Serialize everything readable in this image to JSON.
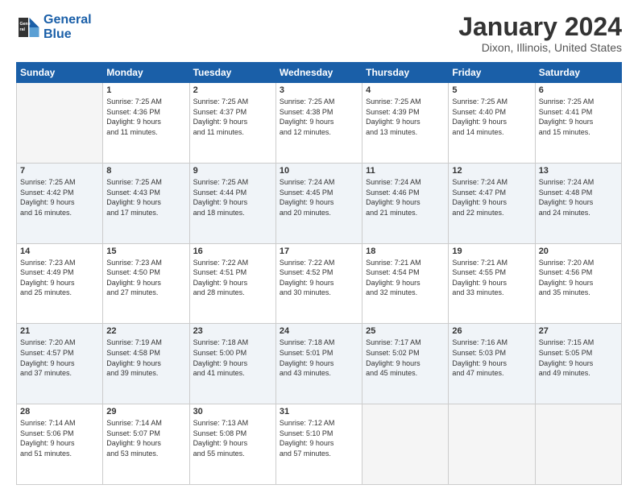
{
  "header": {
    "logo_line1": "General",
    "logo_line2": "Blue",
    "title": "January 2024",
    "subtitle": "Dixon, Illinois, United States"
  },
  "weekdays": [
    "Sunday",
    "Monday",
    "Tuesday",
    "Wednesday",
    "Thursday",
    "Friday",
    "Saturday"
  ],
  "weeks": [
    [
      {
        "day": "",
        "info": ""
      },
      {
        "day": "1",
        "info": "Sunrise: 7:25 AM\nSunset: 4:36 PM\nDaylight: 9 hours\nand 11 minutes."
      },
      {
        "day": "2",
        "info": "Sunrise: 7:25 AM\nSunset: 4:37 PM\nDaylight: 9 hours\nand 11 minutes."
      },
      {
        "day": "3",
        "info": "Sunrise: 7:25 AM\nSunset: 4:38 PM\nDaylight: 9 hours\nand 12 minutes."
      },
      {
        "day": "4",
        "info": "Sunrise: 7:25 AM\nSunset: 4:39 PM\nDaylight: 9 hours\nand 13 minutes."
      },
      {
        "day": "5",
        "info": "Sunrise: 7:25 AM\nSunset: 4:40 PM\nDaylight: 9 hours\nand 14 minutes."
      },
      {
        "day": "6",
        "info": "Sunrise: 7:25 AM\nSunset: 4:41 PM\nDaylight: 9 hours\nand 15 minutes."
      }
    ],
    [
      {
        "day": "7",
        "info": "Sunrise: 7:25 AM\nSunset: 4:42 PM\nDaylight: 9 hours\nand 16 minutes."
      },
      {
        "day": "8",
        "info": "Sunrise: 7:25 AM\nSunset: 4:43 PM\nDaylight: 9 hours\nand 17 minutes."
      },
      {
        "day": "9",
        "info": "Sunrise: 7:25 AM\nSunset: 4:44 PM\nDaylight: 9 hours\nand 18 minutes."
      },
      {
        "day": "10",
        "info": "Sunrise: 7:24 AM\nSunset: 4:45 PM\nDaylight: 9 hours\nand 20 minutes."
      },
      {
        "day": "11",
        "info": "Sunrise: 7:24 AM\nSunset: 4:46 PM\nDaylight: 9 hours\nand 21 minutes."
      },
      {
        "day": "12",
        "info": "Sunrise: 7:24 AM\nSunset: 4:47 PM\nDaylight: 9 hours\nand 22 minutes."
      },
      {
        "day": "13",
        "info": "Sunrise: 7:24 AM\nSunset: 4:48 PM\nDaylight: 9 hours\nand 24 minutes."
      }
    ],
    [
      {
        "day": "14",
        "info": "Sunrise: 7:23 AM\nSunset: 4:49 PM\nDaylight: 9 hours\nand 25 minutes."
      },
      {
        "day": "15",
        "info": "Sunrise: 7:23 AM\nSunset: 4:50 PM\nDaylight: 9 hours\nand 27 minutes."
      },
      {
        "day": "16",
        "info": "Sunrise: 7:22 AM\nSunset: 4:51 PM\nDaylight: 9 hours\nand 28 minutes."
      },
      {
        "day": "17",
        "info": "Sunrise: 7:22 AM\nSunset: 4:52 PM\nDaylight: 9 hours\nand 30 minutes."
      },
      {
        "day": "18",
        "info": "Sunrise: 7:21 AM\nSunset: 4:54 PM\nDaylight: 9 hours\nand 32 minutes."
      },
      {
        "day": "19",
        "info": "Sunrise: 7:21 AM\nSunset: 4:55 PM\nDaylight: 9 hours\nand 33 minutes."
      },
      {
        "day": "20",
        "info": "Sunrise: 7:20 AM\nSunset: 4:56 PM\nDaylight: 9 hours\nand 35 minutes."
      }
    ],
    [
      {
        "day": "21",
        "info": "Sunrise: 7:20 AM\nSunset: 4:57 PM\nDaylight: 9 hours\nand 37 minutes."
      },
      {
        "day": "22",
        "info": "Sunrise: 7:19 AM\nSunset: 4:58 PM\nDaylight: 9 hours\nand 39 minutes."
      },
      {
        "day": "23",
        "info": "Sunrise: 7:18 AM\nSunset: 5:00 PM\nDaylight: 9 hours\nand 41 minutes."
      },
      {
        "day": "24",
        "info": "Sunrise: 7:18 AM\nSunset: 5:01 PM\nDaylight: 9 hours\nand 43 minutes."
      },
      {
        "day": "25",
        "info": "Sunrise: 7:17 AM\nSunset: 5:02 PM\nDaylight: 9 hours\nand 45 minutes."
      },
      {
        "day": "26",
        "info": "Sunrise: 7:16 AM\nSunset: 5:03 PM\nDaylight: 9 hours\nand 47 minutes."
      },
      {
        "day": "27",
        "info": "Sunrise: 7:15 AM\nSunset: 5:05 PM\nDaylight: 9 hours\nand 49 minutes."
      }
    ],
    [
      {
        "day": "28",
        "info": "Sunrise: 7:14 AM\nSunset: 5:06 PM\nDaylight: 9 hours\nand 51 minutes."
      },
      {
        "day": "29",
        "info": "Sunrise: 7:14 AM\nSunset: 5:07 PM\nDaylight: 9 hours\nand 53 minutes."
      },
      {
        "day": "30",
        "info": "Sunrise: 7:13 AM\nSunset: 5:08 PM\nDaylight: 9 hours\nand 55 minutes."
      },
      {
        "day": "31",
        "info": "Sunrise: 7:12 AM\nSunset: 5:10 PM\nDaylight: 9 hours\nand 57 minutes."
      },
      {
        "day": "",
        "info": ""
      },
      {
        "day": "",
        "info": ""
      },
      {
        "day": "",
        "info": ""
      }
    ]
  ]
}
